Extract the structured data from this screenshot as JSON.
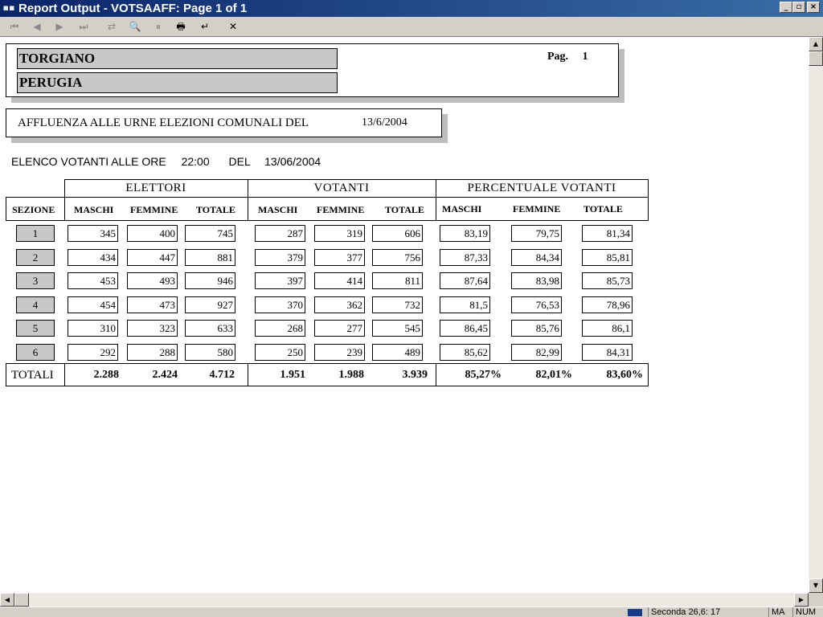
{
  "window": {
    "title": "Report Output - VOTSAAFF: Page 1 of 1",
    "min_label": "_",
    "max_label": "▫",
    "close_label": "×"
  },
  "toolbar": {
    "buttons": [
      {
        "icon": "first-page-icon",
        "glyph": "⏮",
        "enabled": false
      },
      {
        "icon": "prev-page-icon",
        "glyph": "◀",
        "enabled": false
      },
      {
        "icon": "next-page-icon",
        "glyph": "▶",
        "enabled": false
      },
      {
        "icon": "last-page-icon",
        "glyph": "⏭",
        "enabled": false
      },
      {
        "icon": "goto-page-icon",
        "glyph": "⇄",
        "enabled": false
      },
      {
        "icon": "zoom-icon",
        "glyph": "🔍",
        "enabled": true
      },
      {
        "icon": "pause-icon",
        "glyph": "⏸",
        "enabled": false
      },
      {
        "icon": "print-icon",
        "glyph": "🖶",
        "enabled": true
      },
      {
        "icon": "return-icon",
        "glyph": "↵",
        "enabled": true
      },
      {
        "icon": "close-icon",
        "glyph": "✕",
        "enabled": true
      }
    ]
  },
  "report": {
    "comune": "TORGIANO",
    "provincia": "PERUGIA",
    "page_label": "Pag.",
    "page_number": "1",
    "subtitle": "AFFLUENZA ALLE URNE ELEZIONI COMUNALI DEL",
    "subtitle_date": "13/6/2004",
    "elenco_label": "ELENCO VOTANTI ALLE ORE",
    "elenco_time": "22:00",
    "elenco_del": "DEL",
    "elenco_date": "13/06/2004",
    "group_headers": [
      "ELETTORI",
      "VOTANTI",
      "PERCENTUALE VOTANTI"
    ],
    "col_headers": [
      "SEZIONE",
      "MASCHI",
      "FEMMINE",
      "TOTALE",
      "MASCHI",
      "FEMMINE",
      "TOTALE",
      "MASCHI",
      "FEMMINE",
      "TOTALE"
    ],
    "rows": [
      [
        "1",
        "345",
        "400",
        "745",
        "287",
        "319",
        "606",
        "83,19",
        "79,75",
        "81,34"
      ],
      [
        "2",
        "434",
        "447",
        "881",
        "379",
        "377",
        "756",
        "87,33",
        "84,34",
        "85,81"
      ],
      [
        "3",
        "453",
        "493",
        "946",
        "397",
        "414",
        "811",
        "87,64",
        "83,98",
        "85,73"
      ],
      [
        "4",
        "454",
        "473",
        "927",
        "370",
        "362",
        "732",
        "81,5",
        "76,53",
        "78,96"
      ],
      [
        "5",
        "310",
        "323",
        "633",
        "268",
        "277",
        "545",
        "86,45",
        "85,76",
        "86,1"
      ],
      [
        "6",
        "292",
        "288",
        "580",
        "250",
        "239",
        "489",
        "85,62",
        "82,99",
        "84,31"
      ]
    ],
    "totals": [
      "TOTALI",
      "2.288",
      "2.424",
      "4.712",
      "1.951",
      "1.988",
      "3.939",
      "85,27%",
      "82,01%",
      "83,60%"
    ]
  },
  "statusbar": {
    "segments": [
      "Seconda 26,6: 17",
      "MA",
      "NUM"
    ]
  }
}
